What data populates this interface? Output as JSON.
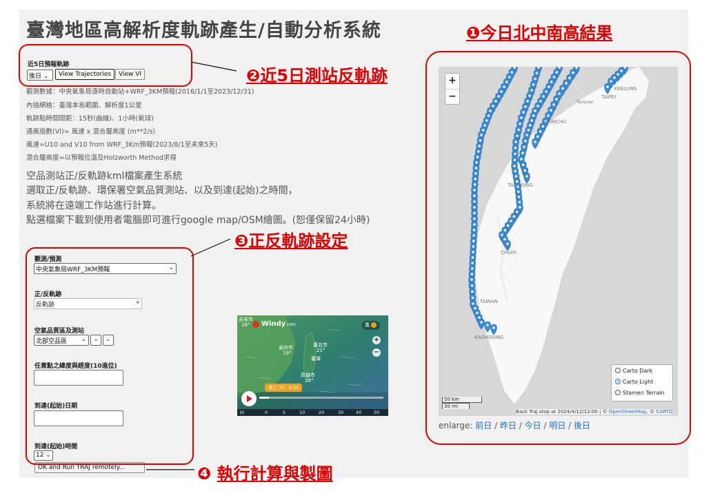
{
  "title": "臺灣地區高解析度軌跡產生/自動分析系統",
  "forecast": {
    "heading": "近5日預報軌跡",
    "day_select": "後日",
    "view_traj_btn": "View Trajectories",
    "view_vi_btn": "View VI"
  },
  "info_lines": [
    "觀測數據：中央氣象局逐時自動站+WRF_3KM預報(2016/1/1至2023/12/31)",
    "內插網格：臺灣本島範圍、解析度1公里",
    "軌跡點時間間距：15秒(曲線)、1小時(氣球)",
    "通風指數(VI)= 風速 x 混合層高度 (m**2/s)",
    "風速=U10 and V10 from WRF_3Km預報(2023/8/1至未來5天)",
    "混合層高度=以預報位溫及Holzworth Method求得"
  ],
  "desc_lines": [
    "空品測站正/反軌跡kml檔案產生系統",
    "選取正/反軌跡、環保署空氣品質測站、以及到達(起始)之時間，",
    "系統將在遠端工作站進行計算。",
    "點選檔案下載到使用者電腦即可進行google map/OSM繪圖。(恕僅保留24小時)"
  ],
  "form": {
    "obs_label": "觀測/預測",
    "obs_value": "中央氣象局WRF_3KM預報",
    "dir_label": "正/反軌跡",
    "dir_value": "反軌跡",
    "station_label": "空氣品質區及測站",
    "station_value": "北部空品區",
    "coord_label": "任意點之緯度與經度(10進位)",
    "date_label": "到達(起始)日期",
    "time_label": "到達(起始)時間",
    "time_value": "12",
    "run_btn": "OK and Run TRAJ remotely..."
  },
  "callouts": {
    "c1": "❶今日北中南高結果",
    "c2": "❷近5日測站反軌跡",
    "c3": "❸正反軌跡設定",
    "c4_num": "❹",
    "c4": "執行計算與製圖"
  },
  "map": {
    "zoom_in": "+",
    "zoom_out": "−",
    "labels": [
      "KEELUNG",
      "TAIPEI",
      "Taoyuan",
      "HSINCHU",
      "TAICHUNG",
      "CHIAYI",
      "TAINAN",
      "KAOHSIUNG"
    ],
    "layers": [
      "Carto Dark",
      "Carto Light",
      "Stamen Terrain"
    ],
    "selected_layer": "Carto Light",
    "scale_km": "50 km",
    "scale_mi": "30 mi",
    "attribution": "Back Traj stop at 2024/4/12/12:00 | © ",
    "attr_osm": "OpenStreetMap",
    "attr_sep": ", © ",
    "attr_carto": "CARTO",
    "marker_color": "#3b8ad4"
  },
  "enlarge": {
    "label": "enlarge: ",
    "links": [
      "前日",
      "昨日",
      "今日",
      "明日",
      "後日"
    ]
  },
  "windy": {
    "city1": "吉安市",
    "temp1": "16°",
    "brand": "Windy",
    "brand_suffix": ".com",
    "city2": "泉州市",
    "temp2": "19°",
    "city3": "臺北市",
    "temp3": "21°",
    "city4": "臺灣",
    "city5": "高雄市",
    "temp5": "24°",
    "wind_btn": "風",
    "time_badge": "周三 10 - 8:00",
    "scale_unit": "kt",
    "scale_ticks": [
      "0",
      "5",
      "10",
      "20",
      "30",
      "40",
      "50"
    ]
  }
}
